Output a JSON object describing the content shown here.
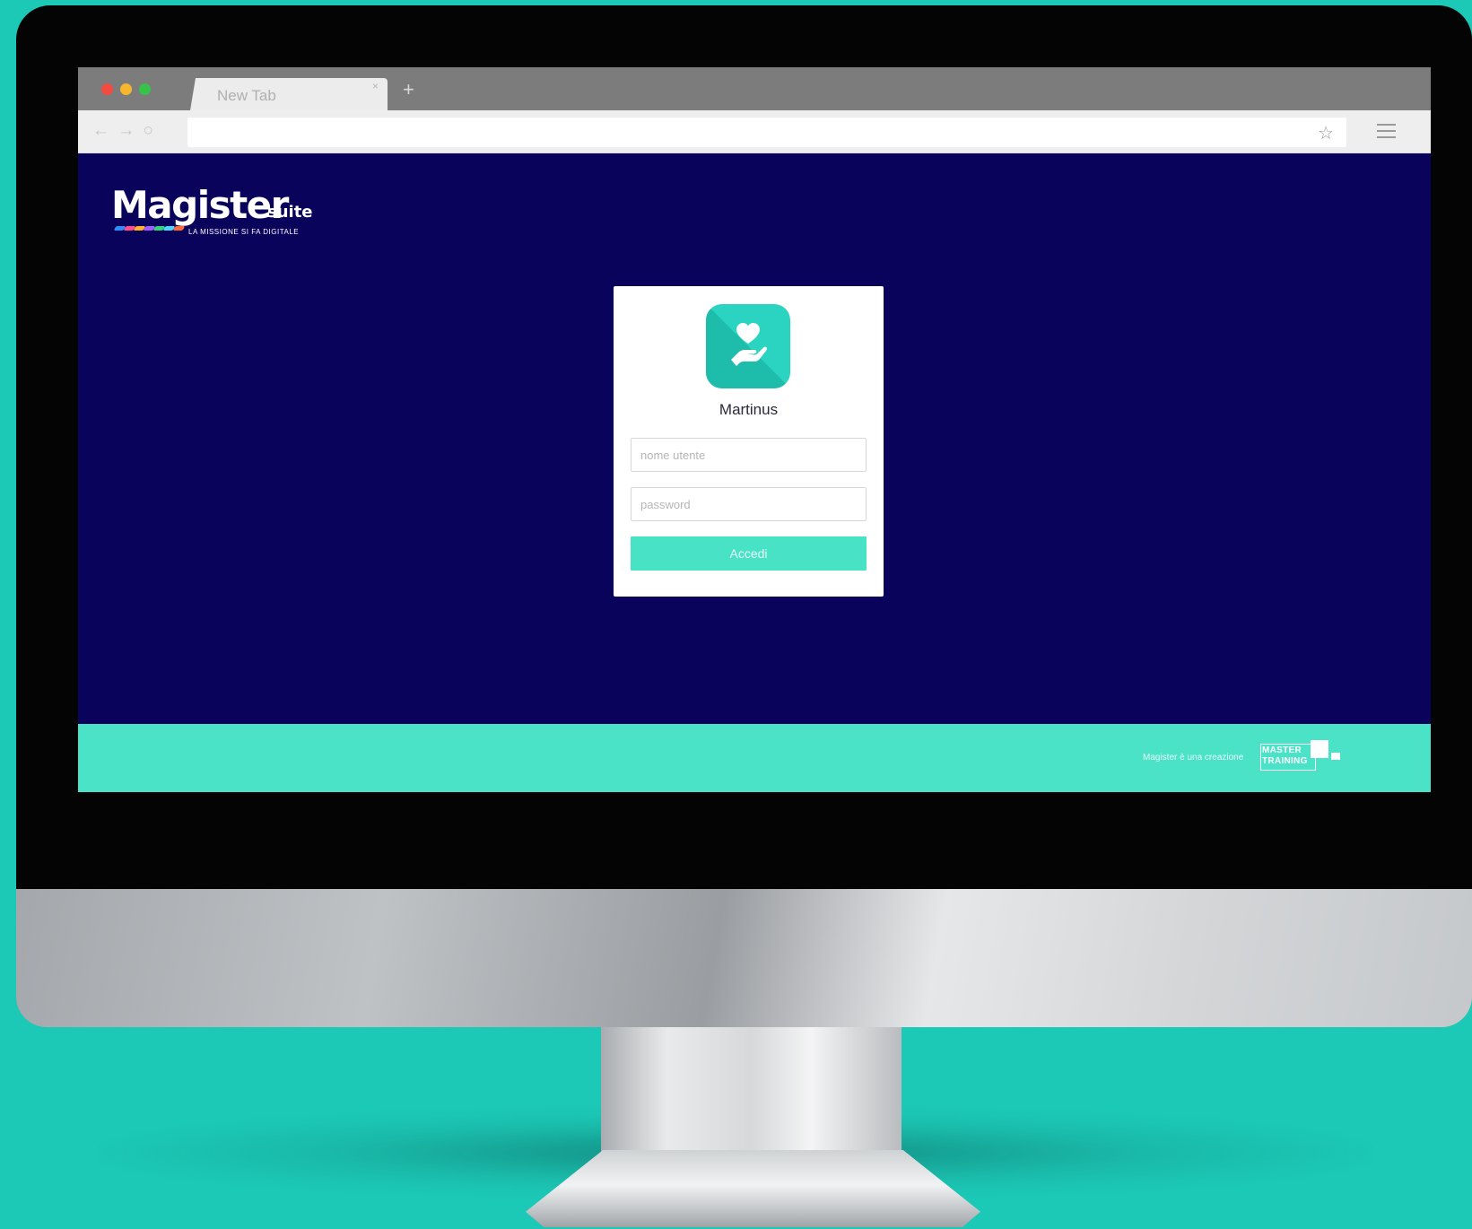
{
  "browser": {
    "tab_title": "New Tab",
    "tab_close": "×",
    "new_tab": "+",
    "nav_icons": "← → ○",
    "address_value": "",
    "bookmark_icon": "☆"
  },
  "header": {
    "brand_name": "Magister",
    "brand_suffix": "suite",
    "brand_tagline": "LA MISSIONE SI FA DIGITALE"
  },
  "login": {
    "app_icon": "heart-in-hand-icon",
    "app_name": "Martinus",
    "username_placeholder": "nome utente",
    "password_placeholder": "password",
    "submit_label": "Accedi"
  },
  "footer": {
    "credit_text": "Magister è una creazione",
    "partner_line1": "MASTER",
    "partner_line2": "TRAINING"
  },
  "colors": {
    "background": "#1cc8b6",
    "page_bg": "#0a035b",
    "accent": "#48e2c7",
    "app_icon": "#2bd4c0"
  }
}
